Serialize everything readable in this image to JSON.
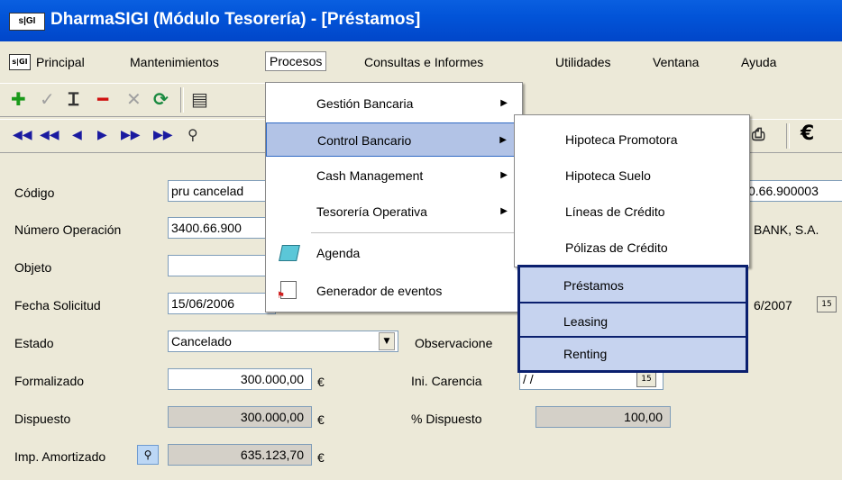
{
  "window": {
    "logo": "s|GI",
    "title": "DharmaSIGI  (Módulo Tesorería) - [Préstamos]"
  },
  "menubar": {
    "logo": "s|GI",
    "items": [
      "Principal",
      "Mantenimientos",
      "Procesos",
      "Consultas e Informes",
      "Utilidades",
      "Ventana",
      "Ayuda"
    ],
    "active": "Procesos"
  },
  "procesos_menu": {
    "items": [
      "Gestión Bancaria",
      "Control Bancario",
      "Cash Management",
      "Tesorería Operativa",
      "Agenda",
      "Generador de eventos"
    ],
    "highlighted": "Control Bancario"
  },
  "control_bancario_menu": {
    "items": [
      "Hipoteca Promotora",
      "Hipoteca Suelo",
      "Líneas de Crédito",
      "Pólizas de Crédito"
    ],
    "boxed_items": [
      "Préstamos",
      "Leasing",
      "Renting"
    ]
  },
  "form": {
    "codigo": {
      "label": "Código",
      "value": "pru cancelad"
    },
    "numero_operacion": {
      "label": "Número Operación",
      "value": "3400.66.900"
    },
    "objeto": {
      "label": "Objeto",
      "value": ""
    },
    "fecha_solicitud": {
      "label": "Fecha Solicitud",
      "value": "15/06/2006"
    },
    "estado": {
      "label": "Estado",
      "value": "Cancelado"
    },
    "observaciones": {
      "label": "Observacione"
    },
    "formalizado": {
      "label": "Formalizado",
      "value": "300.000,00"
    },
    "ini_carencia": {
      "label": "Ini. Carencia",
      "value": "/ /"
    },
    "dispuesto": {
      "label": "Dispuesto",
      "value": "300.000,00"
    },
    "pct_dispuesto": {
      "label": "% Dispuesto",
      "value": "100,00"
    },
    "imp_amortizado": {
      "label": "Imp. Amortizado",
      "value": "635.123,70"
    },
    "currency": "€",
    "right_code": "0.66.900003",
    "right_bank": "BANK, S.A.",
    "right_date": "6/2007"
  },
  "colors": {
    "titlebar": "#0254d8",
    "highlight": "#b2c3e6",
    "box_border": "#0a1f6e"
  }
}
